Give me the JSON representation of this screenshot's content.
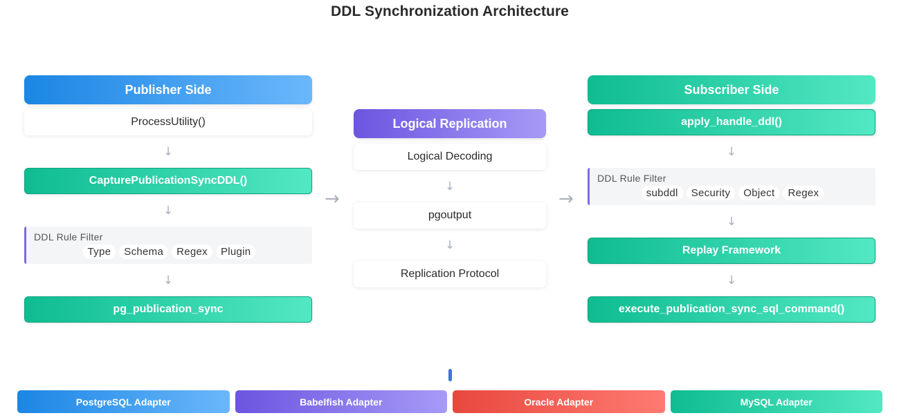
{
  "title": "DDL Synchronization Architecture",
  "publisher": {
    "header": "Publisher Side",
    "process_utility": "ProcessUtility()",
    "capture": "CapturePublicationSyncDDL()",
    "filter": {
      "label": "DDL Rule Filter",
      "chips": [
        "Type",
        "Schema",
        "Regex",
        "Plugin"
      ]
    },
    "sync": "pg_publication_sync"
  },
  "logical": {
    "header": "Logical Replication",
    "decoding": "Logical Decoding",
    "pgoutput": "pgoutput",
    "protocol": "Replication Protocol"
  },
  "subscriber": {
    "header": "Subscriber Side",
    "apply": "apply_handle_ddl()",
    "filter": {
      "label": "DDL Rule Filter",
      "chips": [
        "subddl",
        "Security",
        "Object",
        "Regex"
      ]
    },
    "replay": "Replay Framework",
    "execute": "execute_publication_sync_sql_command()"
  },
  "adapters": [
    "PostgreSQL Adapter",
    "Babelfish Adapter",
    "Oracle Adapter",
    "MySQL Adapter"
  ],
  "icons": {
    "down_arrow": "↓",
    "right_arrow": "→"
  },
  "colors": {
    "blue": "#1b86e4",
    "purple": "#6c55e0",
    "green": "#0fbc91",
    "red": "#e8483e"
  }
}
